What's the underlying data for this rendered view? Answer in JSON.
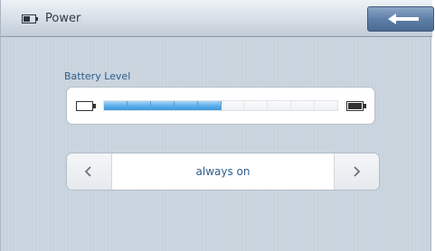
{
  "titlebar": {
    "title": "Power",
    "title_icon": "battery-icon",
    "back_icon": "back-arrow-icon"
  },
  "battery": {
    "label": "Battery Level",
    "level_fraction": 0.5,
    "segments_total": 10,
    "segments_filled": 5,
    "empty_icon": "battery-empty-icon",
    "full_icon": "battery-full-icon",
    "fill_color": "#4fa8e6"
  },
  "backlight_selector": {
    "value": "always on",
    "prev_icon": "chevron-left-icon",
    "next_icon": "chevron-right-icon"
  },
  "colors": {
    "background": "#c9d3dd",
    "accent_blue": "#2d5e8c",
    "back_button": "#5e7fa8"
  }
}
